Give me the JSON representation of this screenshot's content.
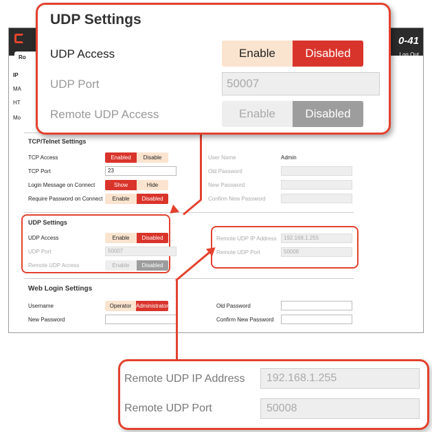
{
  "app": {
    "model_suffix": "0-41",
    "nav_tab": "Ro",
    "logout": "Log Out",
    "side_labels": [
      "IP",
      "MA",
      "HT",
      "Mo"
    ]
  },
  "tcp": {
    "title": "TCP/Telnet Settings",
    "rows": [
      {
        "label": "TCP Access",
        "on": "Enabled",
        "off": "Disable"
      },
      {
        "label": "TCP Port",
        "value": "23"
      },
      {
        "label": "Login Message on Connect",
        "on": "Show",
        "off": "Hide"
      },
      {
        "label": "Require Password on Connect",
        "off": "Enable",
        "on": "Disabled"
      }
    ],
    "right_rows": [
      {
        "label": "User Name",
        "value": "Admin"
      },
      {
        "label": "Old Password"
      },
      {
        "label": "New Password"
      },
      {
        "label": "Confirm New Password"
      }
    ]
  },
  "udp": {
    "title": "UDP Settings",
    "access_label": "UDP Access",
    "enable": "Enable",
    "disabled": "Disabled",
    "port_label": "UDP Port",
    "port_value": "50007",
    "remote_access_label": "Remote UDP Access",
    "remote_ip_label": "Remote UDP IP Address",
    "remote_ip_value": "192.168.1.255",
    "remote_port_label": "Remote UDP Port",
    "remote_port_value": "50008"
  },
  "web": {
    "title": "Web Login Settings",
    "username_label": "Username",
    "operator": "Operator",
    "administrator": "Administrator",
    "new_password_label": "New Password",
    "old_password_label": "Old Password",
    "confirm_label": "Confirm New Password"
  },
  "colors": {
    "accent": "#e3412d",
    "toggle_on": "#d9342b",
    "toggle_off": "#fbe4cf"
  }
}
